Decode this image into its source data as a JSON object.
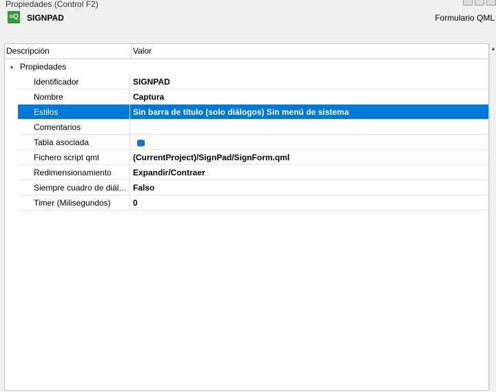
{
  "panel_title": "Propiedades (Control F2)",
  "form": {
    "name": "SIGNPAD",
    "type": "Formulario QML",
    "icon": "qml-form-icon",
    "icon_text": "≡Q"
  },
  "table": {
    "headers": [
      "Descripción",
      "Valor"
    ],
    "group": "Propiedades",
    "rows": [
      {
        "desc": "Identificador",
        "value": "SIGNPAD"
      },
      {
        "desc": "Nombre",
        "value": "Captura"
      },
      {
        "desc": "Estilos",
        "value": "Sin barra de título (solo diálogos) Sin menú de sistema",
        "selected": true
      },
      {
        "desc": "Comentarios",
        "value": ""
      },
      {
        "desc": "Tabla asociada",
        "value": "",
        "icon": "database-icon"
      },
      {
        "desc": "Fichero script qml",
        "value": "(CurrentProject)/SignPad/SignForm.qml"
      },
      {
        "desc": "Redimensionamiento",
        "value": "Expandir/Contraer"
      },
      {
        "desc": "Siempre cuadro de diálogo",
        "value": "Falso"
      },
      {
        "desc": "Timer (Milisegundos)",
        "value": "0"
      }
    ]
  },
  "colors": {
    "selection": "#0078d7",
    "form_icon": "#2e9a3a"
  }
}
